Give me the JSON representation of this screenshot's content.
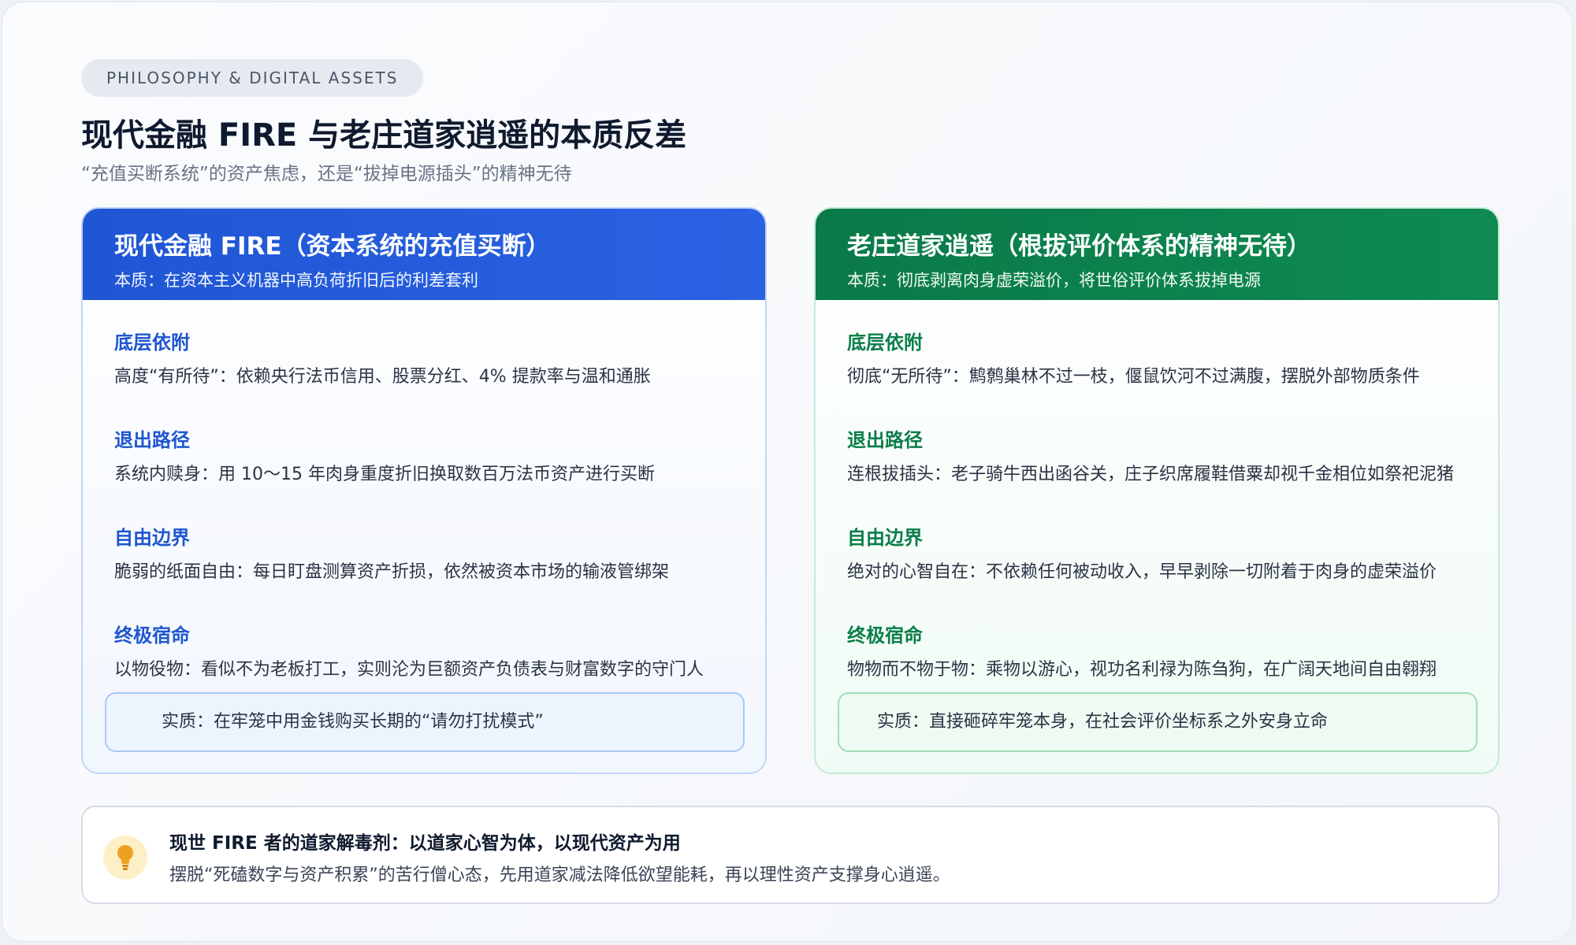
{
  "header": {
    "tag": "PHILOSOPHY & DIGITAL ASSETS",
    "title": "现代金融 FIRE 与老庄道家逍遥的本质反差",
    "subtitle": "“充值买断系统”的资产焦虑，还是“拔掉电源插头”的精神无待"
  },
  "colors": {
    "left_accent": "#1f56d4",
    "right_accent": "#0a7a48",
    "tip_icon": "#f0a020"
  },
  "left_card": {
    "title": "现代金融 FIRE（资本系统的充值买断）",
    "essence": "本质：在资本主义机器中高负荷折旧后的利差套利",
    "sections": [
      {
        "label": "底层依附",
        "text": "高度“有所待”：依赖央行法币信用、股票分红、4% 提款率与温和通胀"
      },
      {
        "label": "退出路径",
        "text": "系统内赎身：用 10～15 年肉身重度折旧换取数百万法币资产进行买断"
      },
      {
        "label": "自由边界",
        "text": "脆弱的纸面自由：每日盯盘测算资产折损，依然被资本市场的输液管绑架"
      },
      {
        "label": "终极宿命",
        "text": "以物役物：看似不为老板打工，实则沦为巨额资产负债表与财富数字的守门人"
      }
    ],
    "summary": "实质：在牢笼中用金钱购买长期的“请勿打扰模式”"
  },
  "right_card": {
    "title": "老庄道家逍遥（根拔评价体系的精神无待）",
    "essence": "本质：彻底剥离肉身虚荣溢价，将世俗评价体系拔掉电源",
    "sections": [
      {
        "label": "底层依附",
        "text": "彻底“无所待”：鹪鹩巢林不过一枝，偃鼠饮河不过满腹，摆脱外部物质条件"
      },
      {
        "label": "退出路径",
        "text": "连根拔插头：老子骑牛西出函谷关，庄子织席履鞋借粟却视千金相位如祭祀泥猪"
      },
      {
        "label": "自由边界",
        "text": "绝对的心智自在：不依赖任何被动收入，早早剥除一切附着于肉身的虚荣溢价"
      },
      {
        "label": "终极宿命",
        "text": "物物而不物于物：乘物以游心，视功名利禄为陈刍狗，在广阔天地间自由翱翔"
      }
    ],
    "summary": "实质：直接砸碎牢笼本身，在社会评价坐标系之外安身立命"
  },
  "tip": {
    "icon": "lightbulb-icon",
    "title": "现世 FIRE 者的道家解毒剂：以道家心智为体，以现代资产为用",
    "text": "摆脱“死磕数字与资产积累”的苦行僧心态，先用道家减法降低欲望能耗，再以理性资产支撑身心逍遥。"
  }
}
